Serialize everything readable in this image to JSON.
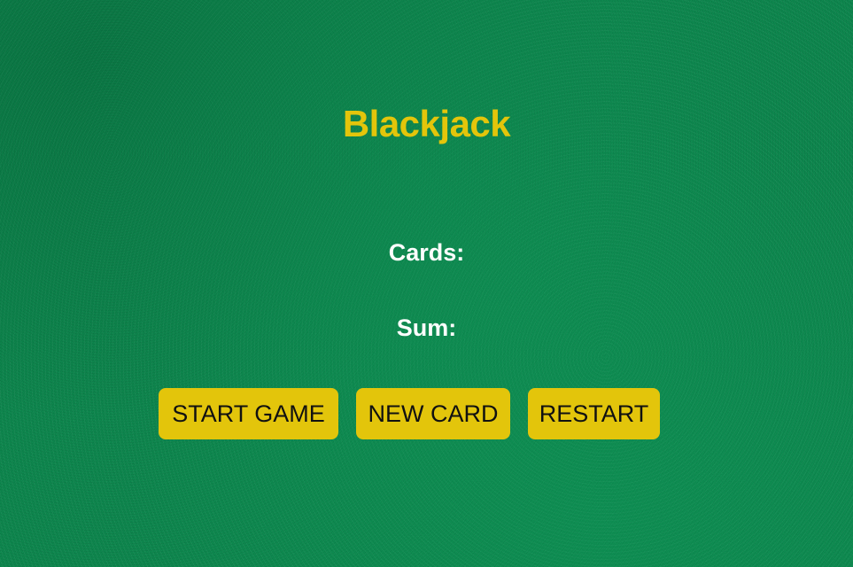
{
  "game": {
    "title": "Blackjack",
    "cards_label": "Cards:",
    "sum_label": "Sum:"
  },
  "buttons": {
    "start_label": "START GAME",
    "new_card_label": "NEW CARD",
    "restart_label": "RESTART"
  },
  "colors": {
    "felt": "#0d8a4e",
    "accent": "#e3c50b",
    "text": "#ffffff",
    "button_text": "#111111"
  }
}
